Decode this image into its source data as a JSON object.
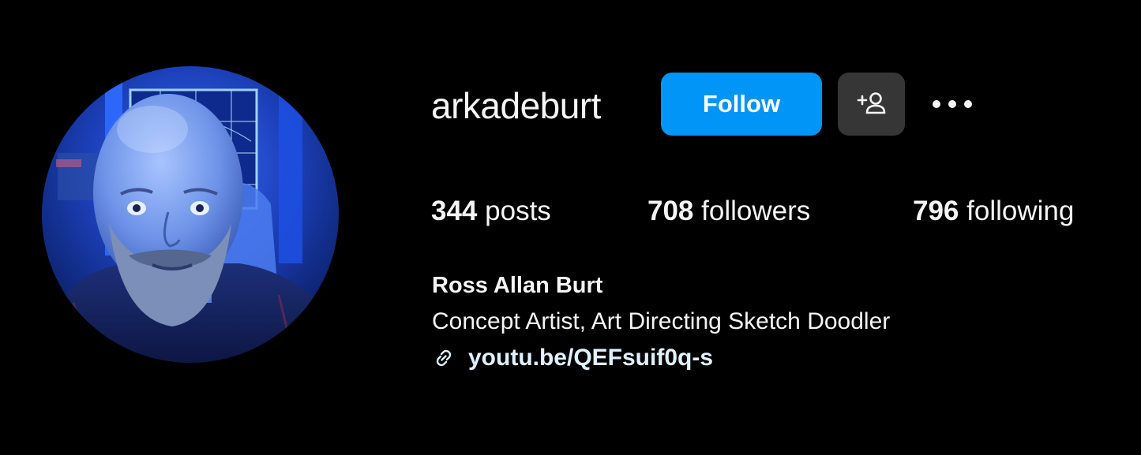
{
  "profile": {
    "username": "arkadeburt",
    "full_name": "Ross Allan Burt",
    "bio": "Concept Artist, Art Directing Sketch Doodler",
    "link": "youtu.be/QEFsuif0q-s"
  },
  "actions": {
    "follow_label": "Follow",
    "suggest_icon": "add-person-icon",
    "more_icon": "more-horizontal-icon"
  },
  "stats": {
    "posts": {
      "count": "344",
      "label": "posts"
    },
    "followers": {
      "count": "708",
      "label": "followers"
    },
    "following": {
      "count": "796",
      "label": "following"
    }
  },
  "colors": {
    "background": "#000000",
    "follow_button": "#0095f6",
    "secondary_button": "#363636",
    "text": "#f5f5f5",
    "link": "#e0f1ff"
  },
  "icons": {
    "link": "link-icon",
    "avatar": "profile-photo"
  }
}
